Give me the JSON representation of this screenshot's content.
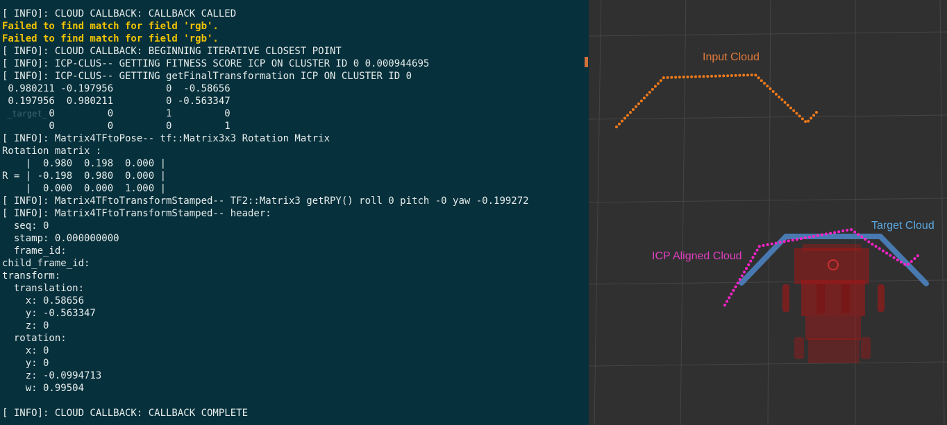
{
  "terminal": {
    "lines": [
      {
        "text": "[ INFO]: CLOUD CALLBACK: CALLBACK CALLED",
        "kind": "info"
      },
      {
        "text": "Failed to find match for field 'rgb'.",
        "kind": "warn"
      },
      {
        "text": "Failed to find match for field 'rgb'.",
        "kind": "warn"
      },
      {
        "text": "[ INFO]: CLOUD CALLBACK: BEGINNING ITERATIVE CLOSEST POINT",
        "kind": "info"
      },
      {
        "text": "[ INFO]: ICP-CLUS-- GETTING FITNESS SCORE ICP ON CLUSTER ID 0 0.000944695",
        "kind": "info"
      },
      {
        "text": "[ INFO]: ICP-CLUS-- GETTING getFinalTransformation ICP ON CLUSTER ID 0",
        "kind": "info"
      },
      {
        "text": " 0.980211 -0.197956         0  -0.58656",
        "kind": "plain"
      },
      {
        "text": " 0.197956  0.980211         0 -0.563347",
        "kind": "plain"
      },
      {
        "text": "        0         0         1         0",
        "kind": "plain"
      },
      {
        "text": "        0         0         0         1",
        "kind": "plain"
      },
      {
        "text": "[ INFO]: Matrix4TFtoPose-- tf::Matrix3x3 Rotation Matrix",
        "kind": "info"
      },
      {
        "text": "Rotation matrix :",
        "kind": "plain"
      },
      {
        "text": "    |  0.980  0.198  0.000 |",
        "kind": "plain"
      },
      {
        "text": "R = | -0.198  0.980  0.000 |",
        "kind": "plain"
      },
      {
        "text": "    |  0.000  0.000  1.000 |",
        "kind": "plain"
      },
      {
        "text": "[ INFO]: Matrix4TFtoTransformStamped-- TF2::Matrix3 getRPY() roll 0 pitch -0 yaw -0.199272",
        "kind": "info"
      },
      {
        "text": "[ INFO]: Matrix4TFtoTransformStamped-- header:",
        "kind": "info"
      },
      {
        "text": "  seq: 0",
        "kind": "plain"
      },
      {
        "text": "  stamp: 0.000000000",
        "kind": "plain"
      },
      {
        "text": "  frame_id:",
        "kind": "plain"
      },
      {
        "text": "child_frame_id:",
        "kind": "plain"
      },
      {
        "text": "transform:",
        "kind": "plain"
      },
      {
        "text": "  translation:",
        "kind": "plain"
      },
      {
        "text": "    x: 0.58656",
        "kind": "plain"
      },
      {
        "text": "    y: -0.563347",
        "kind": "plain"
      },
      {
        "text": "    z: 0",
        "kind": "plain"
      },
      {
        "text": "  rotation:",
        "kind": "plain"
      },
      {
        "text": "    x: 0",
        "kind": "plain"
      },
      {
        "text": "    y: 0",
        "kind": "plain"
      },
      {
        "text": "    z: -0.0994713",
        "kind": "plain"
      },
      {
        "text": "    w: 0.99504",
        "kind": "plain"
      },
      {
        "text": "",
        "kind": "plain"
      },
      {
        "text": "[ INFO]: CLOUD CALLBACK: CALLBACK COMPLETE",
        "kind": "info"
      }
    ],
    "colors": {
      "background": "#06303b",
      "text": "#e6ecec",
      "warning": "#f2c300"
    }
  },
  "viewer": {
    "labels": {
      "input_cloud": "Input Cloud",
      "target_cloud": "Target Cloud",
      "icp_aligned_cloud": "ICP Aligned Cloud"
    },
    "colors": {
      "background": "#303030",
      "grid": "#454545",
      "input_cloud": "#f07a1a",
      "target_cloud": "#4a7db8",
      "icp_aligned_cloud": "#ff22cc",
      "robot_model": "#a01818",
      "input_label": "#e07a3a",
      "target_label": "#5aa8e0",
      "icp_label": "#e040c0"
    }
  }
}
